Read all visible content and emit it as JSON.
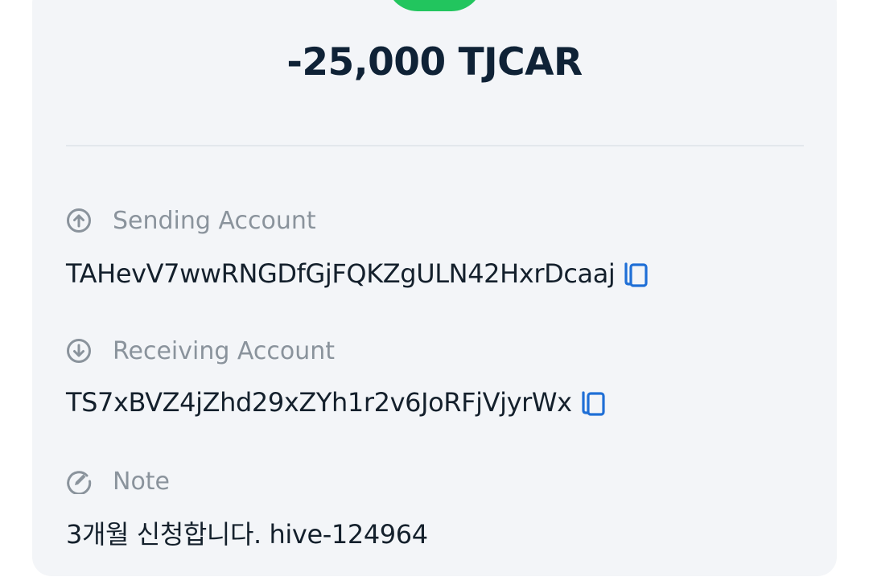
{
  "transaction": {
    "amount": "-25,000 TJCAR",
    "status_color": "#22c55e"
  },
  "sending": {
    "label": "Sending Account",
    "icon": "arrow-up-circle-icon",
    "value": "TAHevV7wwRNGDfGjFQKZgULN42HxrDcaaj",
    "copy_icon": "copy-icon"
  },
  "receiving": {
    "label": "Receiving Account",
    "icon": "arrow-down-circle-icon",
    "value": "TS7xBVZ4jZhd29xZYh1r2v6JoRFjVjyrWx",
    "copy_icon": "copy-icon"
  },
  "note": {
    "label": "Note",
    "icon": "edit-circle-icon",
    "value": "3개월 신청합니다. hive-124964"
  },
  "colors": {
    "card_bg": "#f3f5f8",
    "accent_blue": "#1f6fd6",
    "label_gray": "#8a939c",
    "text_dark": "#14202c"
  }
}
